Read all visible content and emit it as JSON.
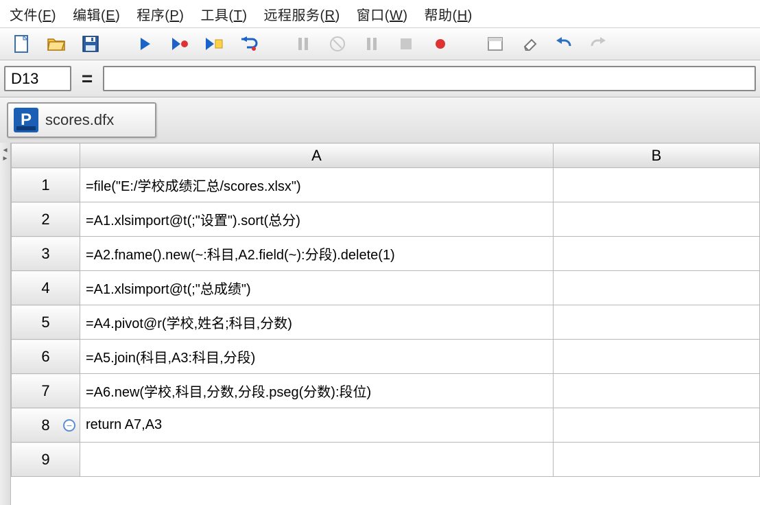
{
  "menu": {
    "items": [
      {
        "label": "文件(",
        "mn": "F",
        "tail": ")"
      },
      {
        "label": "编辑(",
        "mn": "E",
        "tail": ")"
      },
      {
        "label": "程序(",
        "mn": "P",
        "tail": ")"
      },
      {
        "label": "工具(",
        "mn": "T",
        "tail": ")"
      },
      {
        "label": "远程服务(",
        "mn": "R",
        "tail": ")"
      },
      {
        "label": "窗口(",
        "mn": "W",
        "tail": ")"
      },
      {
        "label": "帮助(",
        "mn": "H",
        "tail": ")"
      }
    ]
  },
  "formula_bar": {
    "cell_ref": "D13",
    "eq": "=",
    "value": ""
  },
  "tab": {
    "icon_letter": "P",
    "label": "scores.dfx"
  },
  "grid": {
    "columns": [
      "A",
      "B"
    ],
    "rows": [
      {
        "n": "1",
        "A": "=file(\"E:/学校成绩汇总/scores.xlsx\")",
        "B": "",
        "collapse": false
      },
      {
        "n": "2",
        "A": "=A1.xlsimport@t(;\"设置\").sort(总分)",
        "B": "",
        "collapse": false
      },
      {
        "n": "3",
        "A": "=A2.fname().new(~:科目,A2.field(~):分段).delete(1)",
        "B": "",
        "collapse": false
      },
      {
        "n": "4",
        "A": "=A1.xlsimport@t(;\"总成绩\")",
        "B": "",
        "collapse": false
      },
      {
        "n": "5",
        "A": "=A4.pivot@r(学校,姓名;科目,分数)",
        "B": "",
        "collapse": false
      },
      {
        "n": "6",
        "A": "=A5.join(科目,A3:科目,分段)",
        "B": "",
        "collapse": false
      },
      {
        "n": "7",
        "A": "=A6.new(学校,科目,分数,分段.pseg(分数):段位)",
        "B": "",
        "collapse": false
      },
      {
        "n": "8",
        "A": "return A7,A3",
        "B": "",
        "collapse": true
      },
      {
        "n": "9",
        "A": "",
        "B": "",
        "collapse": false
      }
    ]
  }
}
